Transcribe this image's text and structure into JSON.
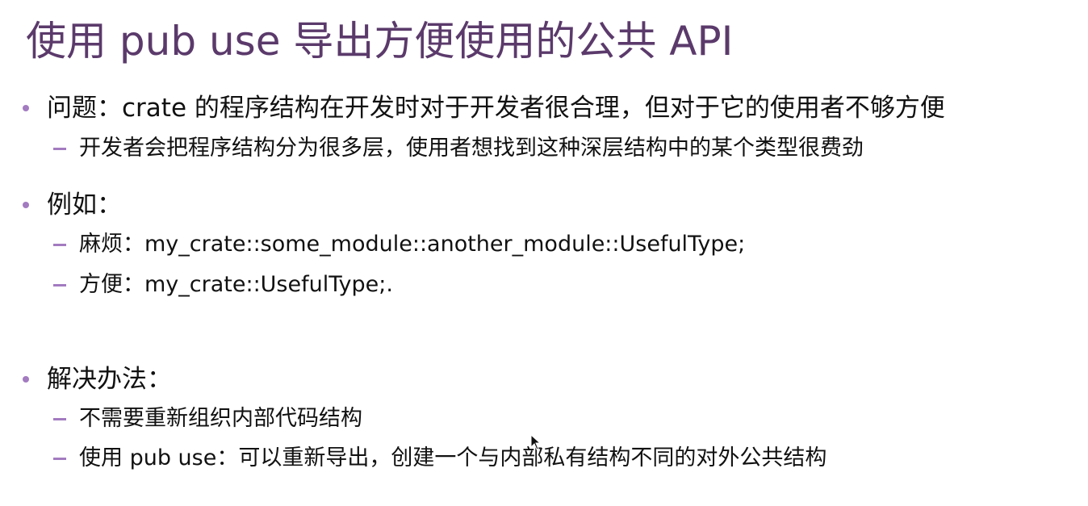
{
  "slide": {
    "title": "使用 pub use 导出方便使用的公共 API",
    "sections": [
      {
        "bullet": "问题：crate 的程序结构在开发时对于开发者很合理，但对于它的使用者不够方便",
        "subs": [
          "开发者会把程序结构分为很多层，使用者想找到这种深层结构中的某个类型很费劲"
        ]
      },
      {
        "bullet": "例如：",
        "subs": [
          "麻烦：my_crate::some_module::another_module::UsefulType;",
          "方便：my_crate::UsefulType;."
        ]
      },
      {
        "bullet": "解决办法：",
        "subs": [
          "不需要重新组织内部代码结构",
          "使用 pub use：可以重新导出，创建一个与内部私有结构不同的对外公共结构"
        ]
      }
    ]
  },
  "colors": {
    "title": "#5b3a6b",
    "bullet_marker": "#a37bc0",
    "text": "#111111",
    "background": "#ffffff"
  },
  "icons": {
    "bullet_marker": "dot",
    "sub_marker": "dash",
    "pointer": "mouse-cursor-icon"
  }
}
